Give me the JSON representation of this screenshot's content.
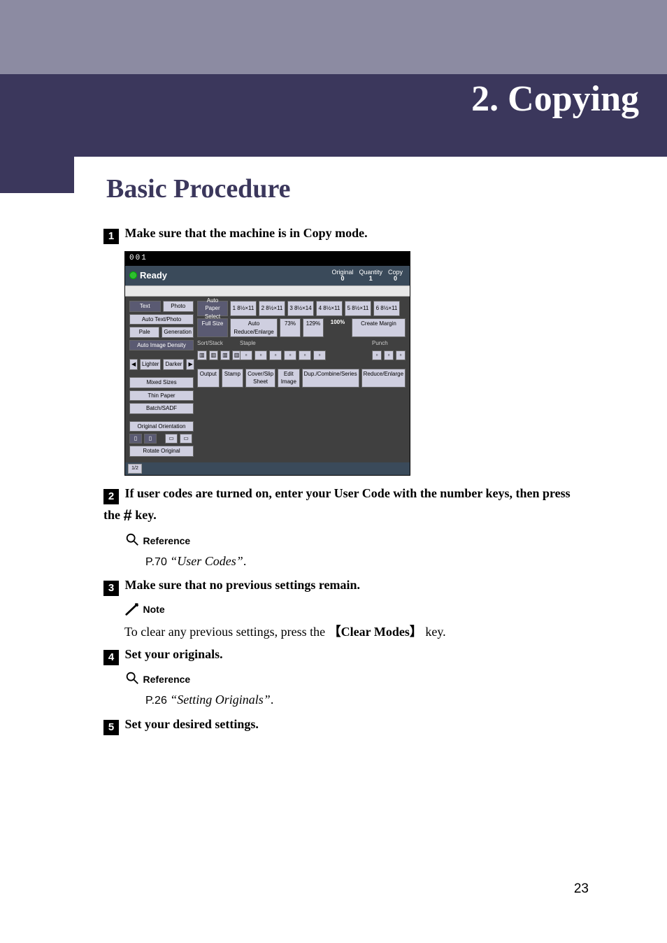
{
  "chapter": {
    "number": "2.",
    "title": "Copying"
  },
  "heading": "Basic Procedure",
  "steps": {
    "s1": {
      "num": "1",
      "text": "Make sure that the machine is in Copy mode."
    },
    "s2": {
      "num": "2",
      "text_a": "If user codes are turned on, enter your User Code with the number keys, then press the ",
      "key": "#",
      "text_b": " key."
    },
    "s3": {
      "num": "3",
      "text": "Make sure that no previous settings remain."
    },
    "s4": {
      "num": "4",
      "text": "Set your originals."
    },
    "s5": {
      "num": "5",
      "text": "Set your desired settings."
    }
  },
  "reference": {
    "label": "Reference"
  },
  "ref1": {
    "page": "P.70 ",
    "title": "“User Codes”",
    "after": "."
  },
  "ref2": {
    "page": "P.26 ",
    "title": "“Setting Originals”",
    "after": "."
  },
  "note": {
    "label": "Note",
    "before": "To clear any previous settings, press the ",
    "key": "Clear Modes",
    "after": " key."
  },
  "page_number": "23",
  "screenshot": {
    "titlebar": "001",
    "status_text": "Ready",
    "status_right": {
      "original_lbl": "Original",
      "original_val": "0",
      "qty_lbl": "Quantity",
      "qty_val": "1",
      "copy_lbl": "Copy",
      "copy_val": "0"
    },
    "left_col": {
      "text": "Text",
      "photo": "Photo",
      "auto_tp": "Auto Text/Photo",
      "pale": "Pale",
      "gen": "Generation",
      "aid": "Auto Image Density",
      "lighter": "Lighter",
      "darker": "Darker",
      "mixed": "Mixed Sizes",
      "thin": "Thin Paper",
      "batch": "Batch/SADF",
      "oo": "Original Orientation",
      "rotate": "Rotate Original"
    },
    "right": {
      "auto_paper": "Auto Paper Select",
      "trays": [
        "1  8½×11",
        "2  8½×11",
        "3  8½×14",
        "4  8½×11",
        "5  8½×11",
        "6  8½×11"
      ],
      "fullsize": "Full Size",
      "are": "Auto Reduce/Enlarge",
      "r1": "73%",
      "r2": "129%",
      "r3": "100%",
      "cm": "Create Margin",
      "sort": "Sort/Stack",
      "staple": "Staple",
      "punch": "Punch",
      "bottom": [
        "Output",
        "Stamp",
        "Cover/Slip Sheet",
        "Edit Image",
        "Dup./Combine/Series",
        "Reduce/Enlarge"
      ]
    },
    "footer": "1/2"
  }
}
